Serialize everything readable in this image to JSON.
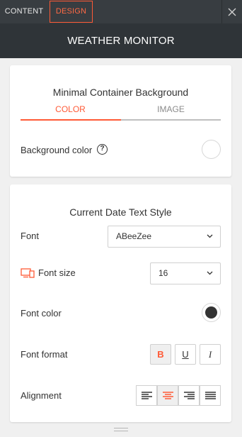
{
  "tabs": {
    "content": "CONTENT",
    "design": "DESIGN"
  },
  "header": {
    "title": "WEATHER MONITOR"
  },
  "background_section": {
    "title": "Minimal Container Background",
    "subtabs": {
      "color": "COLOR",
      "image": "IMAGE"
    },
    "background_color_label": "Background color",
    "help_glyph": "?",
    "background_color_value": "#ffffff"
  },
  "text_style_section": {
    "title": "Current Date Text Style",
    "font_label": "Font",
    "font_value": "ABeeZee",
    "font_size_label": "Font size",
    "font_size_value": "16",
    "font_color_label": "Font color",
    "font_color_value": "#333333",
    "font_format_label": "Font format",
    "format_buttons": {
      "bold": "B",
      "underline": "U",
      "italic": "I"
    },
    "alignment_label": "Alignment",
    "alignment_selected": "center"
  },
  "colors": {
    "accent": "#ff5a36",
    "topbar": "#383d41",
    "header": "#2f3438"
  },
  "icons": [
    "close-icon",
    "help-icon",
    "chevron-down-icon",
    "device-size-icon",
    "align-left-icon",
    "align-center-icon",
    "align-right-icon",
    "align-justify-icon",
    "resize-grip-icon"
  ]
}
